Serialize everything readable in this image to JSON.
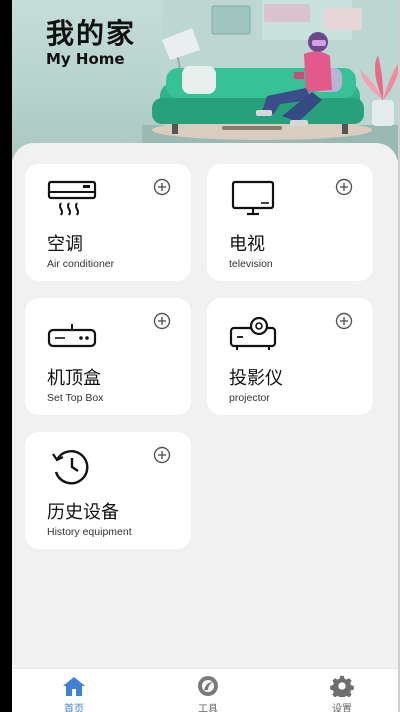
{
  "header": {
    "title": "我的家",
    "subtitle": "My Home"
  },
  "devices": [
    {
      "name": "空调",
      "english": "Air conditioner",
      "icon": "air-conditioner-icon"
    },
    {
      "name": "电视",
      "english": "television",
      "icon": "tv-icon"
    },
    {
      "name": "机顶盒",
      "english": "Set Top Box",
      "icon": "set-top-box-icon"
    },
    {
      "name": "投影仪",
      "english": "projector",
      "icon": "projector-icon"
    },
    {
      "name": "历史设备",
      "english": "History equipment",
      "icon": "history-icon"
    }
  ],
  "add_icon": "plus-circle-icon",
  "tabs": [
    {
      "label": "首页",
      "icon": "home-icon",
      "active": true
    },
    {
      "label": "工具",
      "icon": "tools-icon",
      "active": false
    },
    {
      "label": "设置",
      "icon": "gear-icon",
      "active": false
    }
  ],
  "colors": {
    "accent": "#3f7fd6",
    "background": "#f1f1f1",
    "card": "#ffffff",
    "hero": "#b7d3cd",
    "sofa": "#2fb38a"
  }
}
